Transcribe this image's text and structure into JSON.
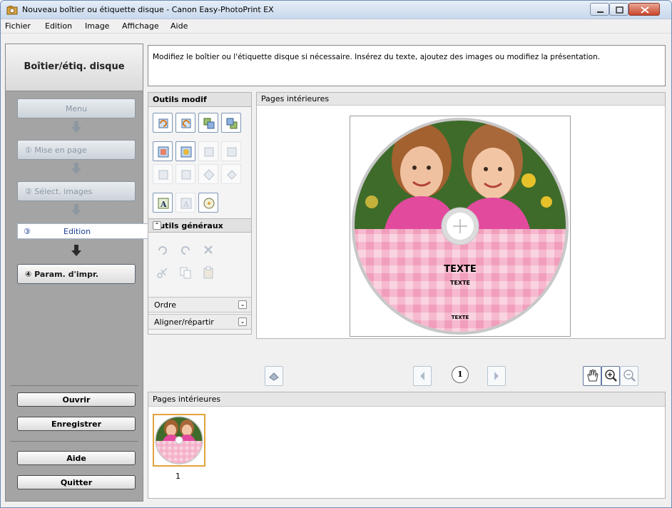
{
  "window": {
    "title": "Nouveau boîtier ou étiquette disque - Canon Easy-PhotoPrint EX"
  },
  "menu": [
    "Fichier",
    "Edition",
    "Image",
    "Affichage",
    "Aide"
  ],
  "sidebar": {
    "header": "Boîtier/étiq. disque",
    "steps": {
      "menu": "Menu",
      "layout": "① Mise en page",
      "select": "② Sélect. images",
      "edit_num": "③",
      "edit": "Edition",
      "print": "④ Param. d'impr."
    },
    "buttons": {
      "open": "Ouvrir",
      "save": "Enregistrer",
      "help": "Aide",
      "quit": "Quitter"
    }
  },
  "instruction": "Modifiez le boîtier ou l'étiquette disque si nécessaire. Insérez du texte, ajoutez des images ou modifiez la présentation.",
  "tools": {
    "edit_header": "Outils modif",
    "general_header": "Outils généraux",
    "order": "Ordre",
    "align": "Aligner/répartir"
  },
  "preview": {
    "header": "Pages intérieures",
    "text_large": "TEXTE",
    "text_small": "TEXTE",
    "text_bottom": "TEXTE"
  },
  "nav": {
    "page": "1"
  },
  "thumbnails": {
    "header": "Pages intérieures",
    "items": [
      {
        "label": "1"
      }
    ]
  },
  "colors": {
    "sidebar_bg": "#a4a4a4",
    "active_step_text": "#1b3f91",
    "selected_thumb_border": "#e2a43c",
    "label_pink": "#f7b6cc"
  },
  "icons": {
    "nav_prev": "triangle-left-icon",
    "nav_next": "triangle-right-icon",
    "hand": "hand-icon",
    "zoom_in": "zoom-in-icon",
    "zoom_out": "zoom-out-icon"
  }
}
